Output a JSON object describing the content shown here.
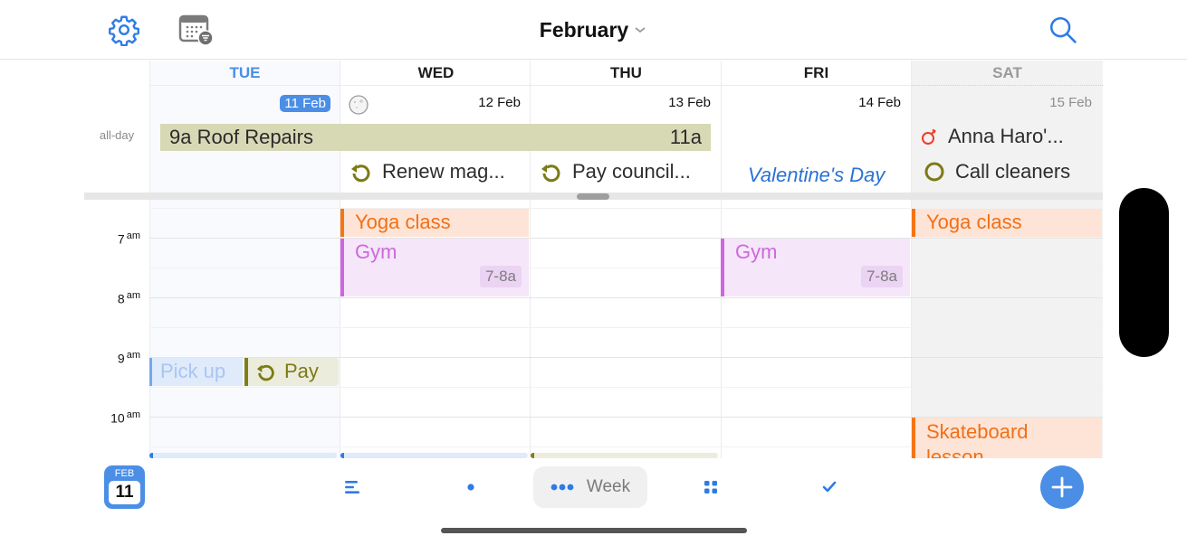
{
  "header": {
    "month_title": "February",
    "settings_icon": "gear-icon",
    "calendar_filter_icon": "calendar-filter-icon",
    "search_icon": "search-icon"
  },
  "days": [
    {
      "name": "TUE",
      "date": "11 Feb",
      "is_today": true
    },
    {
      "name": "WED",
      "date": "12 Feb",
      "moon_phase_icon": "full-moon-icon"
    },
    {
      "name": "THU",
      "date": "13 Feb"
    },
    {
      "name": "FRI",
      "date": "14 Feb"
    },
    {
      "name": "SAT",
      "date": "15 Feb",
      "weekend": true
    }
  ],
  "all_day": {
    "label": "all-day",
    "spanning_event": {
      "start_label": "9a",
      "title": "Roof Repairs",
      "end_label": "11a",
      "start_day": "TUE",
      "end_day": "THU",
      "color": "#d7d9b5"
    },
    "birthday": {
      "day": "SAT",
      "title": "Anna Haro'...",
      "icon": "birthday-icon"
    },
    "tasks": [
      {
        "day": "WED",
        "title": "Renew mag...",
        "icon": "repeat-task-icon"
      },
      {
        "day": "THU",
        "title": "Pay council...",
        "icon": "repeat-task-icon"
      },
      {
        "day": "SAT",
        "title": "Call cleaners",
        "icon": "task-circle-icon"
      }
    ],
    "holiday": {
      "day": "FRI",
      "title": "Valentine's Day"
    }
  },
  "hours": [
    {
      "hour": "7",
      "suffix": "am"
    },
    {
      "hour": "8",
      "suffix": "am"
    },
    {
      "hour": "9",
      "suffix": "am"
    },
    {
      "hour": "10",
      "suffix": "am"
    }
  ],
  "events": [
    {
      "id": "yoga-wed",
      "day": "WED",
      "title": "Yoga class",
      "color": "#f47516"
    },
    {
      "id": "yoga-sat",
      "day": "SAT",
      "title": "Yoga class",
      "color": "#f47516"
    },
    {
      "id": "gym-wed",
      "day": "WED",
      "title": "Gym",
      "time": "7-8a",
      "color": "#cd66e0"
    },
    {
      "id": "gym-fri",
      "day": "FRI",
      "title": "Gym",
      "time": "7-8a",
      "color": "#cd66e0"
    },
    {
      "id": "pickup-tue",
      "day": "TUE",
      "title": "Pick up",
      "color": "#76a7ee"
    },
    {
      "id": "pay-tue",
      "day": "TUE",
      "title": "Pay",
      "color": "#7f7f18",
      "icon": "repeat-task-icon"
    },
    {
      "id": "skate-sat",
      "day": "SAT",
      "title": "Skateboard lesson",
      "color": "#f47516"
    }
  ],
  "bottom_bar": {
    "today_month": "FEB",
    "today_day": "11",
    "view_label": "Week",
    "buttons": [
      "list-view",
      "day-view",
      "week-view",
      "month-view",
      "tasks-view",
      "add"
    ]
  },
  "colors": {
    "accent": "#4a8ee6",
    "task_olive": "#7f7f18",
    "holiday_blue": "#2a72d6",
    "birthday_red": "#ee3b2b"
  }
}
